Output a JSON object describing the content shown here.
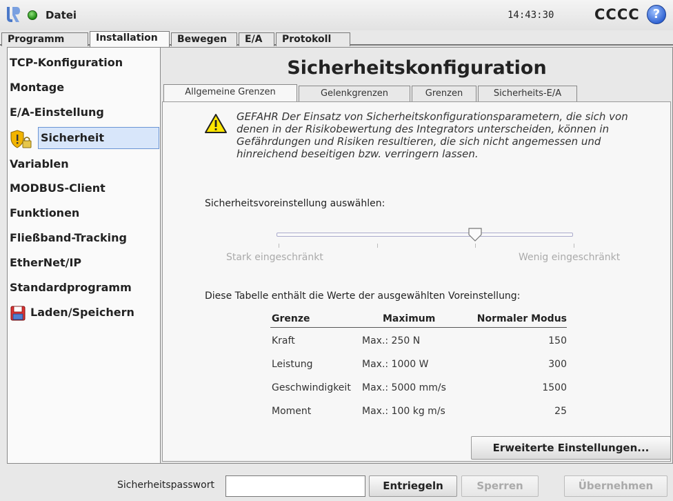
{
  "titlebar": {
    "app_title": "Datei",
    "clock": "14:43:30",
    "robot_name": "CCCC",
    "help_label": "?"
  },
  "main_tabs": [
    {
      "label": "Programm",
      "active": false
    },
    {
      "label": "Installation",
      "active": true
    },
    {
      "label": "Bewegen",
      "active": false
    },
    {
      "label": "E/A",
      "active": false
    },
    {
      "label": "Protokoll",
      "active": false
    }
  ],
  "sidebar": {
    "items": [
      {
        "label": "TCP-Konfiguration"
      },
      {
        "label": "Montage"
      },
      {
        "label": "E/A-Einstellung"
      },
      {
        "label": "Sicherheit",
        "active": true,
        "icon": "shield-lock-icon"
      },
      {
        "label": "Variablen"
      },
      {
        "label": "MODBUS-Client"
      },
      {
        "label": "Funktionen"
      },
      {
        "label": "Fließband-Tracking"
      },
      {
        "label": "EtherNet/IP"
      },
      {
        "label": "Standardprogramm"
      },
      {
        "label": "Laden/Speichern",
        "icon": "save-disk-icon"
      }
    ]
  },
  "page": {
    "title": "Sicherheitskonfiguration",
    "subtabs": [
      {
        "label": "Allgemeine Grenzen",
        "active": true
      },
      {
        "label": "Gelenkgrenzen",
        "active": false
      },
      {
        "label": "Grenzen",
        "active": false
      },
      {
        "label": "Sicherheits-E/A",
        "active": false
      }
    ],
    "warning": "GEFAHR Der Einsatz von Sicherheitskonfigurationsparametern, die sich von denen in der Risikobewertung des Integrators unterscheiden, können in Gefährdungen und Risiken resultieren, die sich nicht angemessen und hinreichend beseitigen bzw. verringern lassen.",
    "preset_label": "Sicherheitsvoreinstellung auswählen:",
    "slider": {
      "left_label": "Stark eingeschränkt",
      "right_label": "Wenig eingeschränkt",
      "positions": 4,
      "selected_index": 2
    },
    "table_caption": "Diese Tabelle enthält die Werte der ausgewählten Voreinstellung:",
    "table": {
      "headers": [
        "Grenze",
        "Maximum",
        "Normaler Modus"
      ],
      "rows": [
        [
          "Kraft",
          "Max.: 250 N",
          "150"
        ],
        [
          "Leistung",
          "Max.: 1000 W",
          "300"
        ],
        [
          "Geschwindigkeit",
          "Max.: 5000 mm/s",
          "1500"
        ],
        [
          "Moment",
          "Max.: 100 kg m/s",
          "25"
        ]
      ]
    },
    "advanced_button": "Erweiterte Einstellungen..."
  },
  "bottombar": {
    "password_label": "Sicherheitspasswort",
    "password_value": "",
    "unlock_button": "Entriegeln",
    "lock_button": "Sperren",
    "apply_button": "Übernehmen"
  },
  "colors": {
    "accent_selection": "#d8e6fa",
    "background": "#e8e8e8",
    "panel": "#f7f7f7"
  }
}
